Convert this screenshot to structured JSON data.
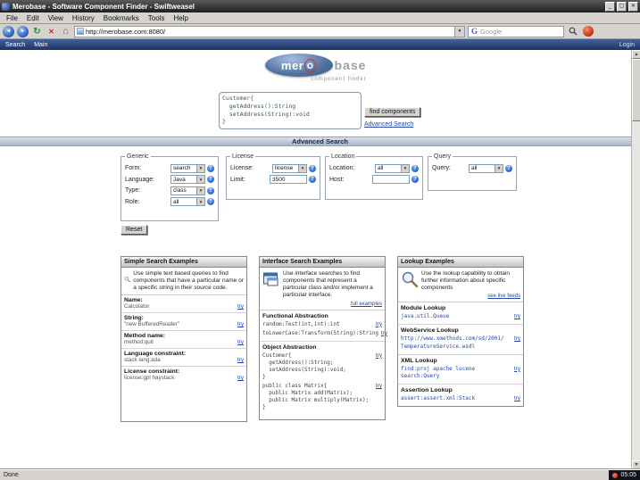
{
  "window": {
    "title": "Merobase - Software Component Finder - Swiftweasel"
  },
  "menubar": {
    "items": [
      "File",
      "Edit",
      "View",
      "History",
      "Bookmarks",
      "Tools",
      "Help"
    ]
  },
  "navbar": {
    "url": "http://merobase.com:8080/",
    "search_engine": "Google"
  },
  "sitebar": {
    "items": [
      "Search",
      "Main"
    ],
    "login": "Login"
  },
  "logo": {
    "mer": "mer",
    "o": "o",
    "base": "base",
    "tagline": "component finder"
  },
  "search": {
    "query": "Customer{\n  getAddress():String\n  setAddress(String):void\n}",
    "find_button": "find components",
    "advanced_link": "Advanced Search"
  },
  "advanced": {
    "header": "Advanced Search",
    "reset_label": "Reset",
    "generic": {
      "legend": "Generic",
      "rows": [
        {
          "label": "Form:",
          "value": "search"
        },
        {
          "label": "Language:",
          "value": "Java"
        },
        {
          "label": "Type:",
          "value": "class"
        },
        {
          "label": "Role:",
          "value": "all"
        }
      ]
    },
    "license": {
      "legend": "License",
      "license_row": {
        "label": "License:",
        "value": "license"
      },
      "limit_row": {
        "label": "Limit:",
        "value": "3500"
      }
    },
    "location": {
      "legend": "Location",
      "location_row": {
        "label": "Location:",
        "value": "all"
      },
      "host_row": {
        "label": "Host:",
        "value": ""
      }
    },
    "query": {
      "legend": "Query",
      "query_row": {
        "label": "Query:",
        "value": "all"
      }
    }
  },
  "panels": [
    {
      "title": "Simple Search Examples",
      "description": "Use simple text based queries to find components that have a particular name or a specific string in their source code.",
      "items": [
        {
          "label": "Name:",
          "value": "Calculator",
          "try_label": "try"
        },
        {
          "label": "String:",
          "value": "\"new BufferedReader\"",
          "try_label": "try"
        },
        {
          "label": "Method name:",
          "value": "method:quit",
          "try_label": "try"
        },
        {
          "label": "Language constraint:",
          "value": "stack lang:ada",
          "try_label": "try"
        },
        {
          "label": "License constraint:",
          "value": "license:gpl haystack",
          "try_label": "try"
        }
      ]
    },
    {
      "title": "Interface Search Examples",
      "description": "Use interface searches to find components that represent a particular class and/or implement a particular interface.",
      "more": "full examples",
      "sections": [
        {
          "heading": "Functional Abstraction",
          "items": [
            {
              "code": "random:Test(int,int):int",
              "try_label": "try"
            },
            {
              "code": "toLowerCase:Transform(String):String",
              "try_label": "try"
            }
          ]
        },
        {
          "heading": "Object Abstraction",
          "items": [
            {
              "code": "Customer{\n  getAddress():String;\n  setAddress(String):void;\n}",
              "try_label": "try"
            },
            {
              "code": "public class Matrix{\n  public Matrix add(Matrix);\n  public Matrix multiply(Matrix);\n}",
              "try_label": "try"
            }
          ]
        }
      ]
    },
    {
      "title": "Lookup Examples",
      "description": "Use the lookup capability to obtain further information about specific components",
      "more": "see live feeds",
      "sections": [
        {
          "heading": "Module Lookup",
          "items": [
            {
              "code": "java.util.Queue",
              "try_label": "try"
            }
          ]
        },
        {
          "heading": "WebService Lookup",
          "items": [
            {
              "code": "http://www.xmethods.com/sd/2001/\nTemperatureService.wsdl",
              "try_label": "try"
            }
          ]
        },
        {
          "heading": "XML Lookup",
          "items": [
            {
              "code": "find:proj apache lucene\nsearch:Query",
              "try_label": "try"
            }
          ]
        },
        {
          "heading": "Assertion Lookup",
          "items": [
            {
              "code": "assert:assert.xml:Stack",
              "try_label": "try"
            }
          ]
        }
      ]
    }
  ],
  "statusbar": {
    "text": "Done"
  },
  "taskbar": {
    "time": "05:05"
  },
  "icons": {
    "help": "?",
    "minimize": "_",
    "maximize": "▢",
    "close": "✕",
    "back": "◄",
    "forward": "►",
    "reload": "↻",
    "stop": "✕",
    "home": "⌂",
    "dropdown": "▼",
    "google_g": "G",
    "scroll_up": "▲",
    "scroll_down": "▼"
  }
}
